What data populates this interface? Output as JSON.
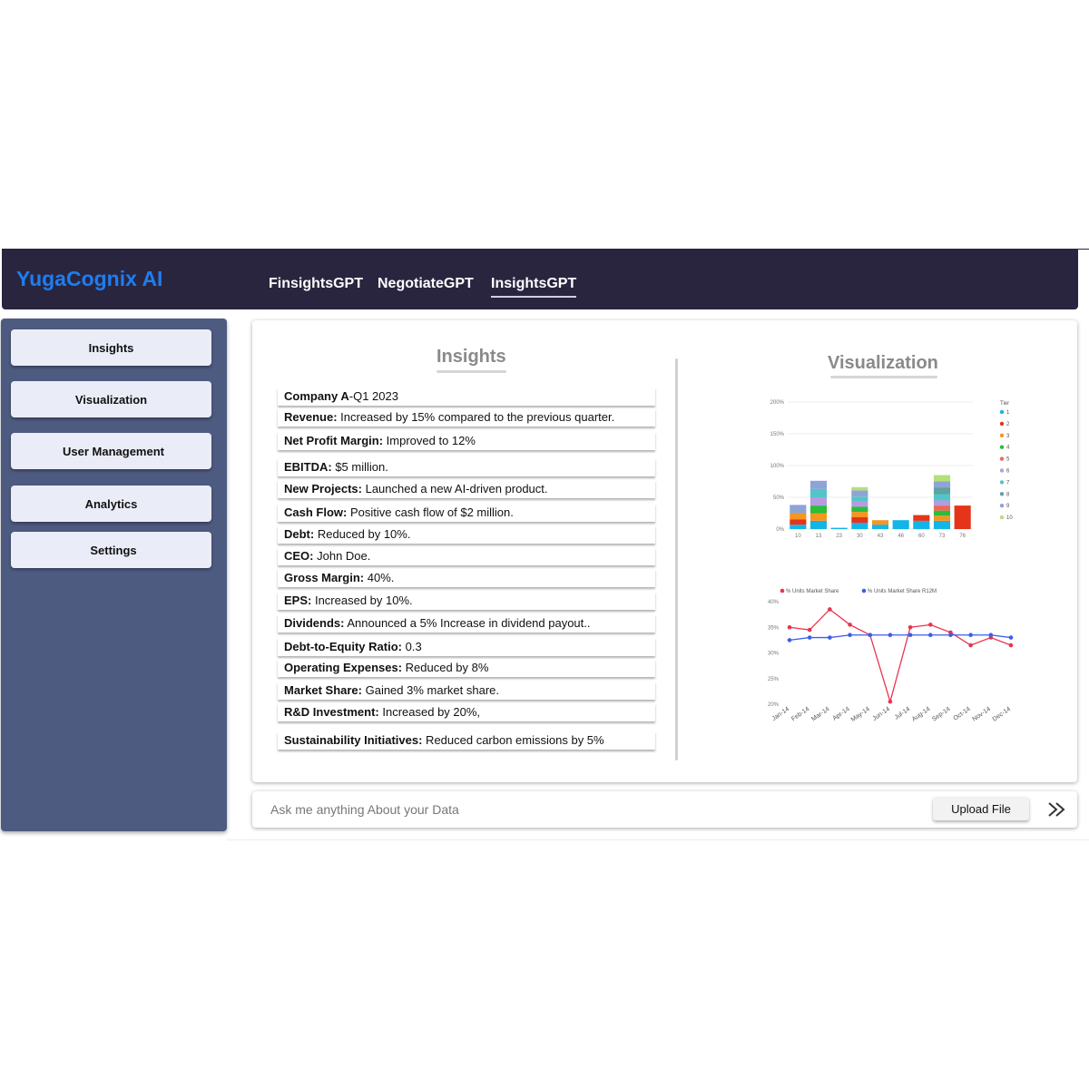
{
  "header": {
    "brand": "YugaCognix AI",
    "tabs": [
      {
        "label": "FinsightsGPT",
        "active": false
      },
      {
        "label": "NegotiateGPT",
        "active": false
      },
      {
        "label": "InsightsGPT",
        "active": true
      }
    ]
  },
  "sidebar": {
    "items": [
      {
        "label": "Insights"
      },
      {
        "label": "Visualization"
      },
      {
        "label": "User Management"
      },
      {
        "label": "Analytics"
      },
      {
        "label": "Settings"
      }
    ]
  },
  "insights": {
    "title": "Insights",
    "rows": [
      {
        "key": "Company A",
        "value": "-Q1 2023"
      },
      {
        "key": "Revenue:",
        "value": " Increased by 15% compared to the previous quarter."
      },
      {
        "key": "Net Profit Margin:",
        "value": " Improved to 12%"
      },
      {
        "key": "EBITDA:",
        "value": " $5 million."
      },
      {
        "key": "New Projects:",
        "value": " Launched a new AI-driven product."
      },
      {
        "key": "Cash Flow:",
        "value": " Positive cash flow of $2 million."
      },
      {
        "key": "Debt:",
        "value": " Reduced by 10%."
      },
      {
        "key": "CEO:",
        "value": " John Doe."
      },
      {
        "key": "Gross Margin:",
        "value": " 40%."
      },
      {
        "key": "EPS:",
        "value": " Increased by 10%."
      },
      {
        "key": "Dividends:",
        "value": " Announced a 5% Increase in dividend payout.."
      },
      {
        "key": "Debt-to-Equity Ratio:",
        "value": " 0.3"
      },
      {
        "key": "Operating Expenses:",
        "value": " Reduced by 8%"
      },
      {
        "key": "Market Share:",
        "value": " Gained 3% market share."
      },
      {
        "key": "R&D Investment:",
        "value": " Increased by 20%,"
      },
      {
        "key": "Sustainability Initiatives:",
        "value": " Reduced carbon emissions by 5%"
      }
    ]
  },
  "visualization": {
    "title": "Visualization"
  },
  "chart_data": [
    {
      "type": "bar",
      "stacked": true,
      "legend_title": "Tier",
      "legend_placement": "right",
      "series_names": [
        "1",
        "2",
        "3",
        "4",
        "5",
        "6",
        "7",
        "8",
        "9",
        "10"
      ],
      "colors": [
        "#12b5e8",
        "#e5341a",
        "#f5961f",
        "#2bbd3b",
        "#eb6a54",
        "#b79be0",
        "#53c5c8",
        "#5fa2a0",
        "#8fa4d6",
        "#b4e07a"
      ],
      "categories": [
        "10",
        "13",
        "23",
        "30",
        "43",
        "46",
        "60",
        "73",
        "76"
      ],
      "stacks": [
        [
          7,
          8,
          10,
          0,
          0,
          0,
          0,
          0,
          13,
          0
        ],
        [
          13,
          0,
          12,
          12,
          0,
          13,
          13,
          0,
          13,
          0
        ],
        [
          2,
          0,
          0,
          0,
          0,
          0,
          0,
          0,
          0,
          0
        ],
        [
          10,
          9,
          8,
          8,
          0,
          8,
          8,
          0,
          10,
          5
        ],
        [
          7,
          0,
          7,
          0,
          0,
          0,
          0,
          0,
          0,
          0
        ],
        [
          14,
          0,
          0,
          0,
          0,
          0,
          0,
          0,
          0,
          0
        ],
        [
          13,
          9,
          0,
          0,
          0,
          0,
          0,
          0,
          0,
          0
        ],
        [
          13,
          0,
          8,
          8,
          8,
          8,
          10,
          10,
          10,
          10
        ],
        [
          0,
          37,
          0,
          0,
          0,
          0,
          0,
          0,
          0,
          0
        ]
      ],
      "ylim": [
        0,
        200
      ],
      "yticks": [
        "0%",
        "50%",
        "100%",
        "150%",
        "200%"
      ],
      "grid": true
    },
    {
      "type": "line",
      "x": [
        "Jan-14",
        "Feb-14",
        "Mar-14",
        "Apr-14",
        "May-14",
        "Jun-14",
        "Jul-14",
        "Aug-14",
        "Sep-14",
        "Oct-14",
        "Nov-14",
        "Dec-14"
      ],
      "series": [
        {
          "name": "% Units Market Share",
          "color": "#e8344f",
          "values": [
            35,
            34.5,
            38.5,
            35.5,
            33.5,
            20.5,
            35,
            35.5,
            34,
            31.5,
            33,
            31.5
          ]
        },
        {
          "name": "% Units Market Share R12M",
          "color": "#3d5de8",
          "values": [
            32.5,
            33,
            33,
            33.5,
            33.5,
            33.5,
            33.5,
            33.5,
            33.5,
            33.5,
            33.5,
            33
          ]
        }
      ],
      "ylim": [
        20,
        40
      ],
      "yticks": [
        "20%",
        "25%",
        "30%",
        "35%",
        "40%"
      ],
      "legend_placement": "top-left",
      "grid": false
    }
  ],
  "chat": {
    "placeholder": "Ask me anything About your Data",
    "upload_label": "Upload File",
    "send_icon": "double-chevron-right-icon"
  }
}
